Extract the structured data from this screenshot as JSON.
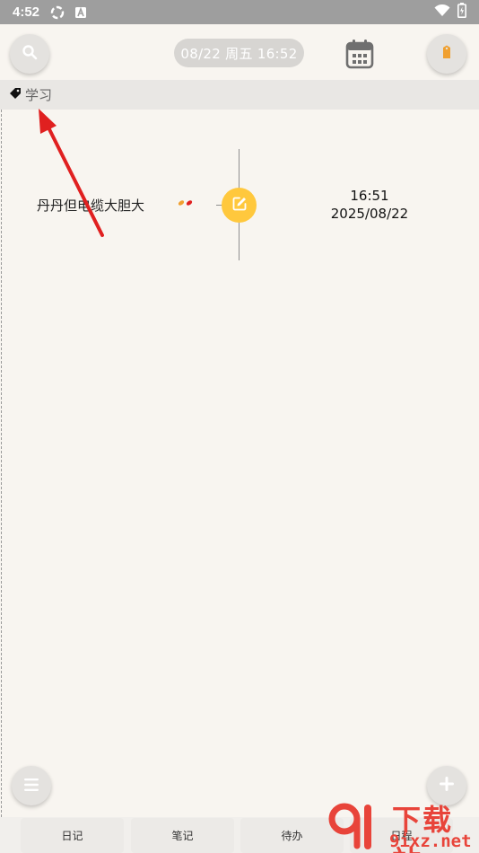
{
  "status_bar": {
    "time": "4:52"
  },
  "header": {
    "datetime": "08/22 周五  16:52"
  },
  "category": {
    "label": "学习"
  },
  "entry": {
    "text": "丹丹但电缆大胆大",
    "time": "16:51",
    "date": "2025/08/22"
  },
  "tabs": [
    {
      "label": "日记"
    },
    {
      "label": "笔记"
    },
    {
      "label": "待办"
    },
    {
      "label": "日程"
    }
  ],
  "watermark": {
    "line1": "下载站",
    "line2": "9ixz.net"
  },
  "colors": {
    "accent_yellow": "#ffc83d",
    "annotation_red": "#e02020",
    "background": "#f8f5f0",
    "tag_orange": "#f0a030"
  },
  "icons": {
    "search": "search-icon",
    "calendar": "calendar-icon",
    "tag": "tag-icon",
    "edit": "edit-icon",
    "menu": "menu-icon",
    "add": "plus-icon"
  }
}
